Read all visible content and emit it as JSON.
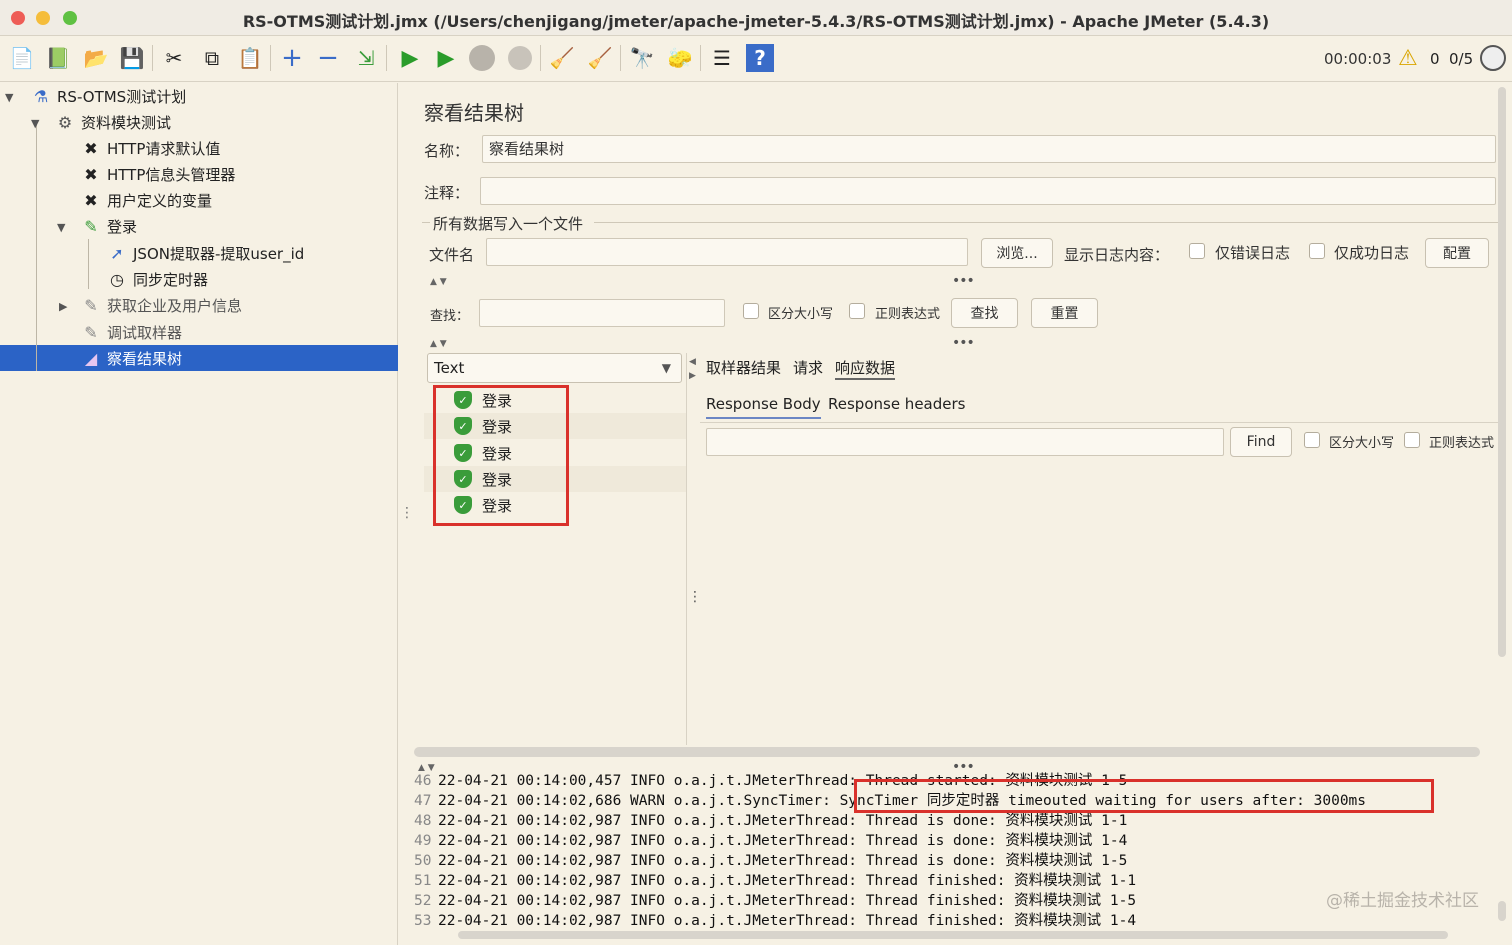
{
  "window": {
    "title": "RS-OTMS测试计划.jmx (/Users/chenjigang/jmeter/apache-jmeter-5.4.3/RS-OTMS测试计划.jmx) - Apache JMeter (5.4.3)"
  },
  "toolbar": {
    "icons": [
      "new-icon",
      "templates-icon",
      "open-icon",
      "save-icon",
      "cut-icon",
      "copy-icon",
      "paste-icon",
      "expand-icon",
      "collapse-icon",
      "toggle-icon",
      "start-icon",
      "start-no-pause-icon",
      "stop-icon",
      "shutdown-icon",
      "clear-icon",
      "clear-all-icon",
      "search-icon",
      "reset-search-icon",
      "function-helper-icon",
      "help-icon"
    ],
    "elapsed": "00:00:03",
    "warning_count": "0",
    "threads": "0/5"
  },
  "tree": {
    "nodes": [
      {
        "label": "RS-OTMS测试计划",
        "icon": "test-plan-icon"
      },
      {
        "label": "资料模块测试",
        "icon": "thread-group-icon"
      },
      {
        "label": "HTTP请求默认值",
        "icon": "config-icon"
      },
      {
        "label": "HTTP信息头管理器",
        "icon": "config-icon"
      },
      {
        "label": "用户定义的变量",
        "icon": "config-icon"
      },
      {
        "label": "登录",
        "icon": "sampler-icon"
      },
      {
        "label": "JSON提取器-提取user_id",
        "icon": "extractor-icon"
      },
      {
        "label": "同步定时器",
        "icon": "timer-icon"
      },
      {
        "label": "获取企业及用户信息",
        "icon": "sampler-icon"
      },
      {
        "label": "调试取样器",
        "icon": "sampler-icon"
      },
      {
        "label": "察看结果树",
        "icon": "listener-icon"
      }
    ]
  },
  "panel": {
    "title": "察看结果树",
    "name_label": "名称：",
    "name_value": "察看结果树",
    "comment_label": "注释：",
    "comment_value": "",
    "file_group_label": "所有数据写入一个文件",
    "filename_label": "文件名",
    "filename_value": "",
    "browse_button": "浏览...",
    "log_content_label": "显示日志内容：",
    "errors_only": "仅错误日志",
    "success_only": "仅成功日志",
    "configure_button": "配置",
    "search_label": "查找：",
    "search_value": "",
    "case_sensitive": "区分大小写",
    "regex": "正则表达式",
    "find_button": "查找",
    "reset_button": "重置"
  },
  "results": {
    "renderer": "Text",
    "items": [
      "登录",
      "登录",
      "登录",
      "登录",
      "登录"
    ],
    "tabs": [
      "取样器结果",
      "请求",
      "响应数据"
    ],
    "active_tab": "响应数据",
    "subtabs": [
      "Response Body",
      "Response headers"
    ],
    "find_button": "Find",
    "case_sensitive": "区分大小写",
    "regex": "正则表达式"
  },
  "log": {
    "lines": [
      {
        "n": "46",
        "text": "22-04-21 00:14:00,457 INFO o.a.j.t.JMeterThread: Thread started: 资料模块测试 1-5"
      },
      {
        "n": "47",
        "text": "22-04-21 00:14:02,686 WARN o.a.j.t.SyncTimer: SyncTimer 同步定时器 timeouted waiting for users after: 3000ms"
      },
      {
        "n": "48",
        "text": "22-04-21 00:14:02,987 INFO o.a.j.t.JMeterThread: Thread is done: 资料模块测试 1-1"
      },
      {
        "n": "49",
        "text": "22-04-21 00:14:02,987 INFO o.a.j.t.JMeterThread: Thread is done: 资料模块测试 1-4"
      },
      {
        "n": "50",
        "text": "22-04-21 00:14:02,987 INFO o.a.j.t.JMeterThread: Thread is done: 资料模块测试 1-5"
      },
      {
        "n": "51",
        "text": "22-04-21 00:14:02,987 INFO o.a.j.t.JMeterThread: Thread finished: 资料模块测试 1-1"
      },
      {
        "n": "52",
        "text": "22-04-21 00:14:02,987 INFO o.a.j.t.JMeterThread: Thread finished: 资料模块测试 1-5"
      },
      {
        "n": "53",
        "text": "22-04-21 00:14:02,987 INFO o.a.j.t.JMeterThread: Thread finished: 资料模块测试 1-4"
      }
    ],
    "watermark": "@稀土掘金技术社区"
  },
  "colors": {
    "background": "#f6f1e4",
    "selection": "#2b63c6",
    "highlight": "#d9312b",
    "success": "#3a9c3a"
  }
}
